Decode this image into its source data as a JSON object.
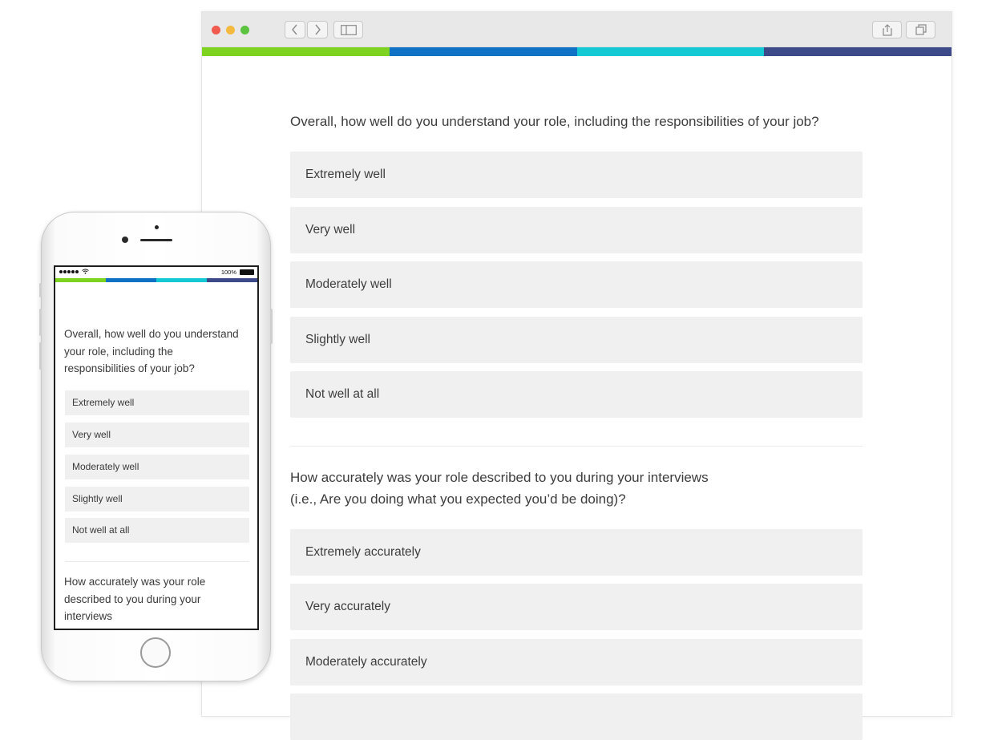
{
  "colors": {
    "bar": [
      "#7ed321",
      "#0f72c4",
      "#14c8d4",
      "#3c4a8a"
    ],
    "option_bg": "#f0f0f0",
    "window_red": "#f05a4f",
    "window_yellow": "#f4b93f",
    "window_green": "#5cc341"
  },
  "browser": {
    "toolbar_icons": [
      "back-icon",
      "forward-icon",
      "sidebar-icon",
      "share-icon",
      "tabs-icon"
    ],
    "questions": [
      {
        "text": "Overall, how well do you understand your role, including the responsibilities of your job?",
        "options": [
          "Extremely well",
          "Very well",
          "Moderately well",
          "Slightly well",
          "Not well at all"
        ]
      },
      {
        "line1": "How accurately was your role described to you during your interviews",
        "line2": "(i.e., Are you doing what you expected you’d be doing)?",
        "options": [
          "Extremely accurately",
          "Very accurately",
          "Moderately accurately"
        ]
      }
    ]
  },
  "phone": {
    "battery": "100%",
    "questions": [
      {
        "lines": [
          "Overall, how well do you understand",
          "your role, including the",
          "responsibilities of your job?"
        ],
        "options": [
          "Extremely well",
          "Very well",
          "Moderately well",
          "Slightly well",
          "Not well at all"
        ]
      },
      {
        "lines": [
          "How accurately was your role",
          "described to you during your",
          "interviews"
        ]
      }
    ]
  }
}
